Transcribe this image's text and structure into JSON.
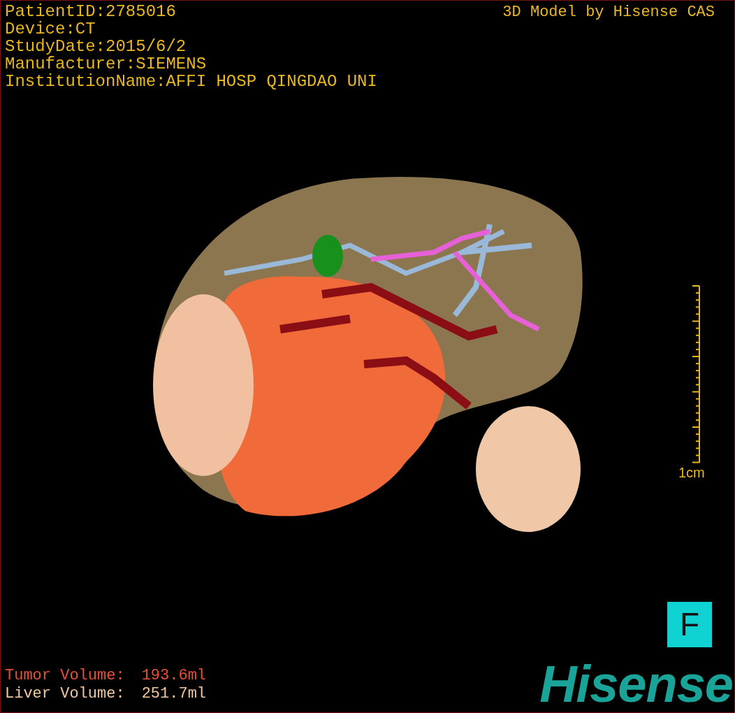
{
  "study_info": [
    "PatientID:2785016",
    "Device:CT",
    "StudyDate:2015/6/2",
    "Manufacturer:SIEMENS",
    "InstitutionName:AFFI HOSP QINGDAO UNI"
  ],
  "model_credit": "3D Model by Hisense CAS",
  "scale_bar": {
    "label": "1cm"
  },
  "orientation_marker": "F",
  "volumes": [
    {
      "label": "Tumor Volume:",
      "value": "193.6ml",
      "color": "#e8503a"
    },
    {
      "label": "Liver Volume:",
      "value": "251.7ml",
      "color": "#f0c8a0"
    }
  ],
  "logo": "Hisense"
}
